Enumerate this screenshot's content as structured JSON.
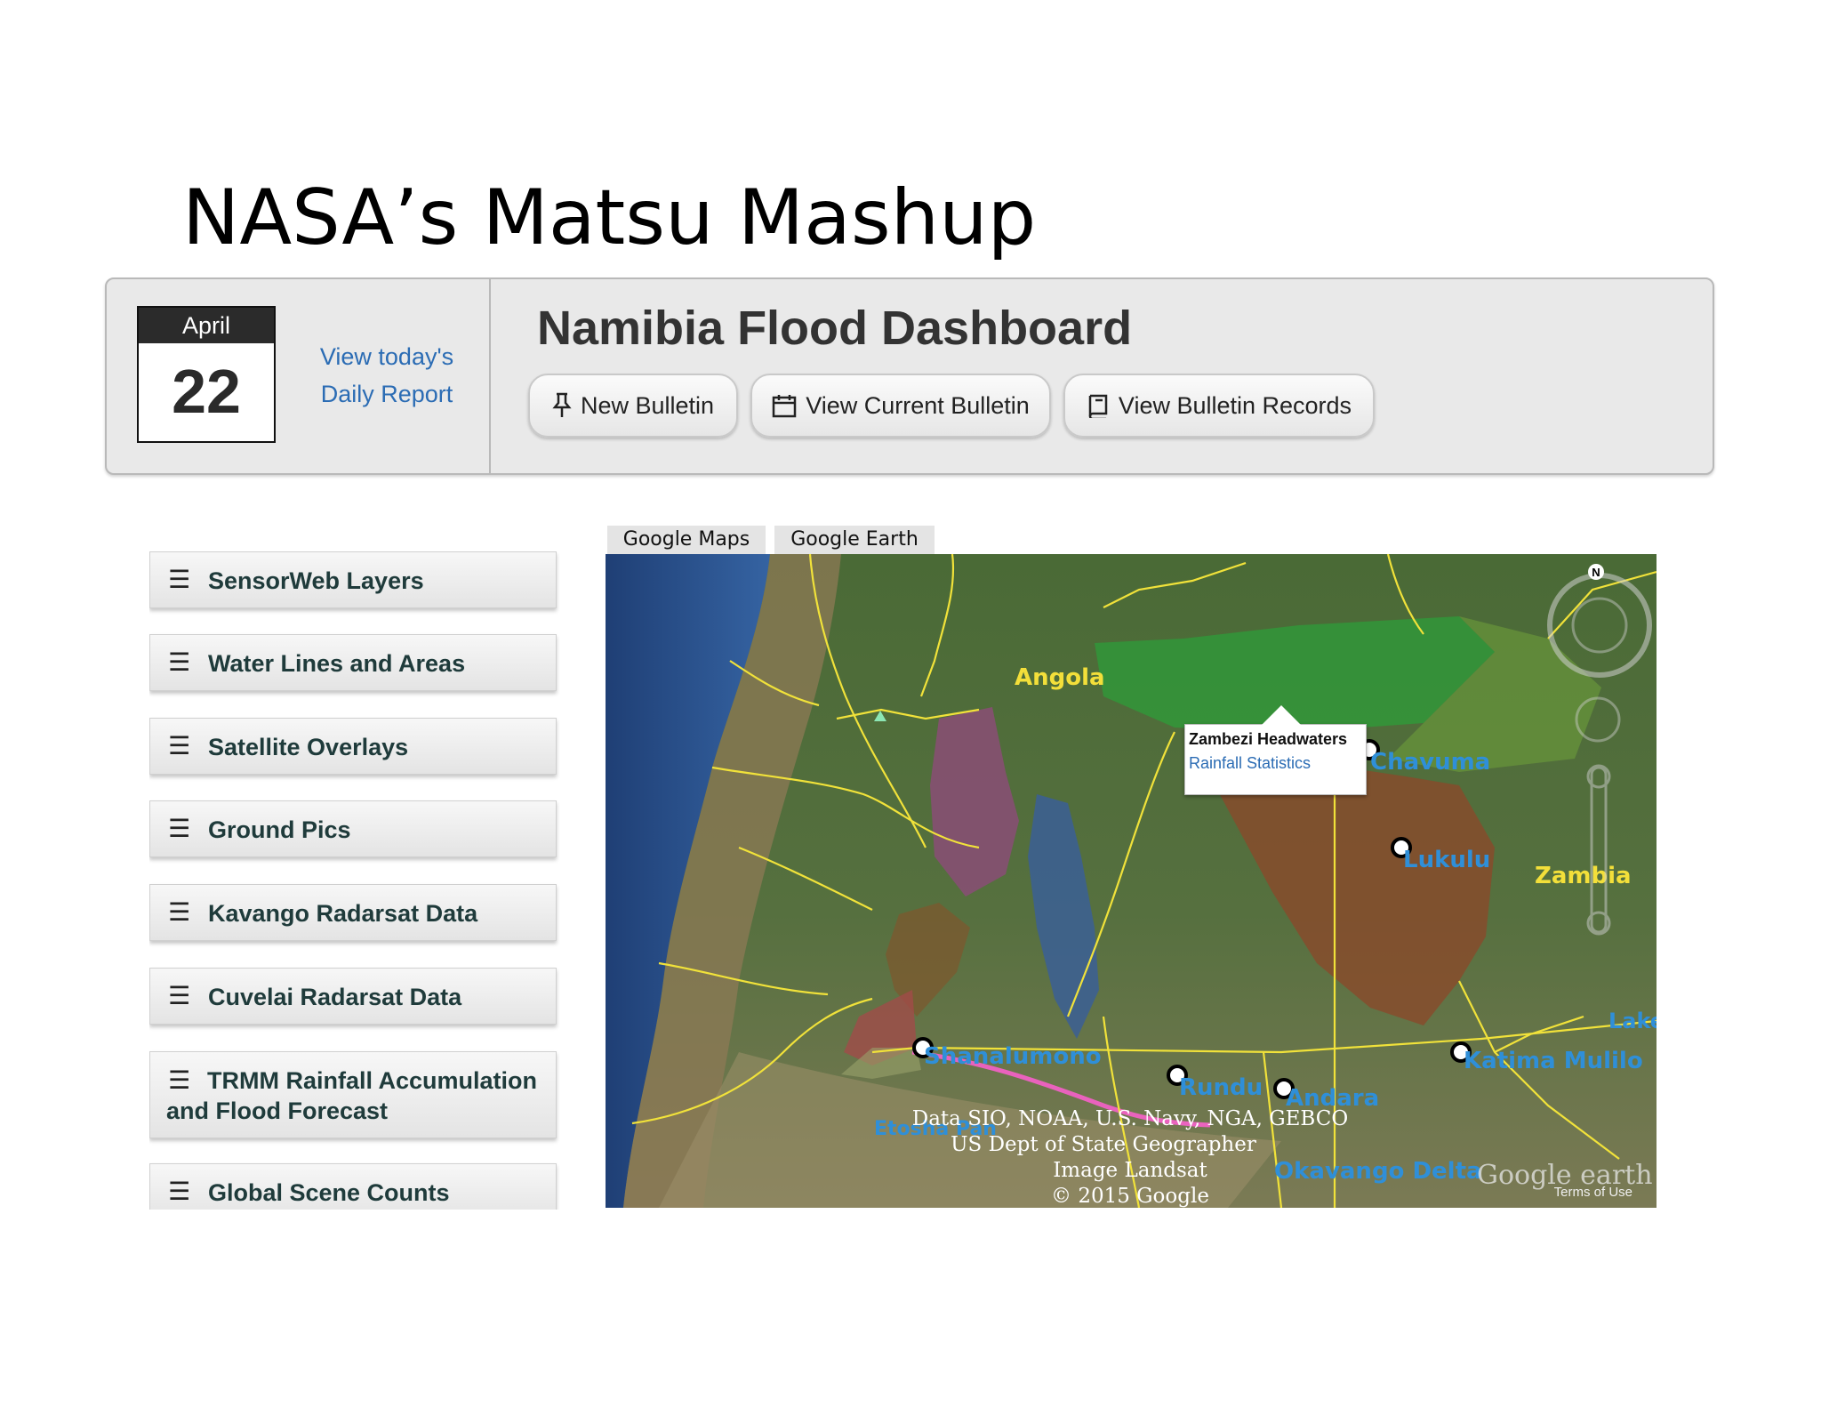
{
  "slide_title": "NASA’s Matsu Mashup",
  "calendar": {
    "month": "April",
    "day": "22"
  },
  "daily_report_link": "View today's Daily Report",
  "dashboard_title": "Namibia Flood Dashboard",
  "buttons": {
    "new_bulletin": "New Bulletin",
    "view_current": "View Current Bulletin",
    "view_records": "View Bulletin Records"
  },
  "sidebar": {
    "items": [
      {
        "label": "SensorWeb Layers"
      },
      {
        "label": "Water Lines and Areas"
      },
      {
        "label": "Satellite Overlays"
      },
      {
        "label": "Ground Pics"
      },
      {
        "label": "Kavango Radarsat Data"
      },
      {
        "label": "Cuvelai Radarsat Data"
      },
      {
        "label": "TRMM Rainfall Accumulation and Flood Forecast"
      },
      {
        "label": "Global Scene Counts"
      }
    ]
  },
  "map_tabs": [
    "Google Maps",
    "Google Earth"
  ],
  "map": {
    "labels": {
      "angola": "Angola",
      "zambia": "Zambia",
      "chavuma": "Chavuma",
      "lukulu": "Lukulu",
      "shanalumono": "Shanalumono",
      "rundu": "Rundu",
      "andara": "Andara",
      "katima": "Katima Mulilo",
      "okavango": "Okavango Delta",
      "etosha": "Etosha Pan",
      "lake": "Lake"
    },
    "popup": {
      "title": "Zambezi Headwaters",
      "link": "Rainfall Statistics"
    },
    "attribution": {
      "line1": "Data SIO, NOAA, U.S. Navy, NGA, GEBCO",
      "line2": "US Dept of State Geographer",
      "line3": "Image Landsat",
      "line4": "© 2015 Google"
    },
    "google_earth": "Google earth",
    "terms": "Terms of Use",
    "north": "N",
    "colors": {
      "ocean": "#274c86",
      "land": "#4d6b3a",
      "border": "#f1e23a",
      "zambezi_green": "#2f9a3a",
      "brown": "#8a4a2a",
      "purple": "#8a4e76",
      "blue": "#3b5f95",
      "link": "#2b6cb4",
      "place_label_yellow": "#f3df3a",
      "place_label_blue": "#2f8fd8"
    }
  }
}
